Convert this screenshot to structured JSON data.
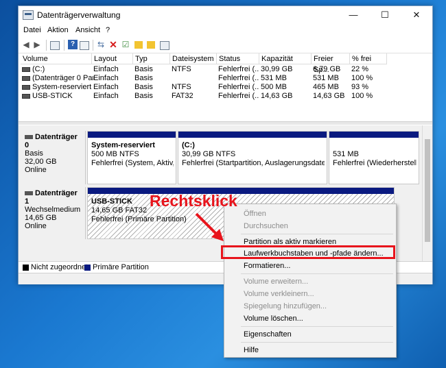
{
  "window": {
    "title": "Datenträgerverwaltung",
    "controls": {
      "minimize": "—",
      "maximize": "☐",
      "close": "✕"
    }
  },
  "menu": [
    "Datei",
    "Aktion",
    "Ansicht",
    "?"
  ],
  "toolbar_icons": [
    "back-icon",
    "forward-icon",
    "console-tree-icon",
    "help-icon",
    "properties-icon",
    "connect-icon",
    "delete-icon",
    "check-icon",
    "folder-up-icon",
    "search-icon",
    "list-icon"
  ],
  "volumes": {
    "columns": [
      "Volume",
      "Layout",
      "Typ",
      "Dateisystem",
      "Status",
      "Kapazität",
      "Freier Sp...",
      "% frei"
    ],
    "rows": [
      {
        "volume": "(C:)",
        "layout": "Einfach",
        "typ": "Basis",
        "fs": "NTFS",
        "status": "Fehlerfrei (...",
        "kap": "30,99 GB",
        "frei": "6,79 GB",
        "pct": "22 %"
      },
      {
        "volume": "(Datenträger 0 Par...",
        "layout": "Einfach",
        "typ": "Basis",
        "fs": "",
        "status": "Fehlerfrei (...",
        "kap": "531 MB",
        "frei": "531 MB",
        "pct": "100 %"
      },
      {
        "volume": "System-reserviert",
        "layout": "Einfach",
        "typ": "Basis",
        "fs": "NTFS",
        "status": "Fehlerfrei (...",
        "kap": "500 MB",
        "frei": "465 MB",
        "pct": "93 %"
      },
      {
        "volume": "USB-STICK",
        "layout": "Einfach",
        "typ": "Basis",
        "fs": "FAT32",
        "status": "Fehlerfrei (...",
        "kap": "14,63 GB",
        "frei": "14,63 GB",
        "pct": "100 %"
      }
    ]
  },
  "disks": [
    {
      "name": "Datenträger 0",
      "type": "Basis",
      "size": "32,00 GB",
      "state": "Online",
      "partitions": [
        {
          "name": "System-reserviert",
          "size": "500 MB NTFS",
          "status": "Fehlerfrei (System, Aktiv, Pri"
        },
        {
          "name": "(C:)",
          "size": "30,99 GB NTFS",
          "status": "Fehlerfrei (Startpartition, Auslagerungsdatei, Abst"
        },
        {
          "name": "",
          "size": "531 MB",
          "status": "Fehlerfrei (Wiederherstellung"
        }
      ]
    },
    {
      "name": "Datenträger 1",
      "type": "Wechselmedium",
      "size": "14,65 GB",
      "state": "Online",
      "partitions": [
        {
          "name": "USB-STICK",
          "size": "14,65 GB FAT32",
          "status": "Fehlerfrei (Primäre Partition)"
        }
      ]
    }
  ],
  "legend": [
    {
      "label": "Nicht zugeordnet",
      "color": "#000000"
    },
    {
      "label": "Primäre Partition",
      "color": "#0a1a80"
    }
  ],
  "context_menu": {
    "items": [
      {
        "label": "Öffnen",
        "enabled": false
      },
      {
        "label": "Durchsuchen",
        "enabled": false
      },
      {
        "label": "Partition als aktiv markieren",
        "enabled": true
      },
      {
        "label": "Laufwerkbuchstaben und -pfade ändern...",
        "enabled": true
      },
      {
        "label": "Formatieren...",
        "enabled": true
      },
      {
        "label": "Volume erweitern...",
        "enabled": false
      },
      {
        "label": "Volume verkleinern...",
        "enabled": false
      },
      {
        "label": "Spiegelung hinzufügen...",
        "enabled": false
      },
      {
        "label": "Volume löschen...",
        "enabled": true
      },
      {
        "label": "Eigenschaften",
        "enabled": true
      },
      {
        "label": "Hilfe",
        "enabled": true
      }
    ]
  },
  "annotation": {
    "text": "Rechtsklick",
    "color": "#e8141c"
  }
}
